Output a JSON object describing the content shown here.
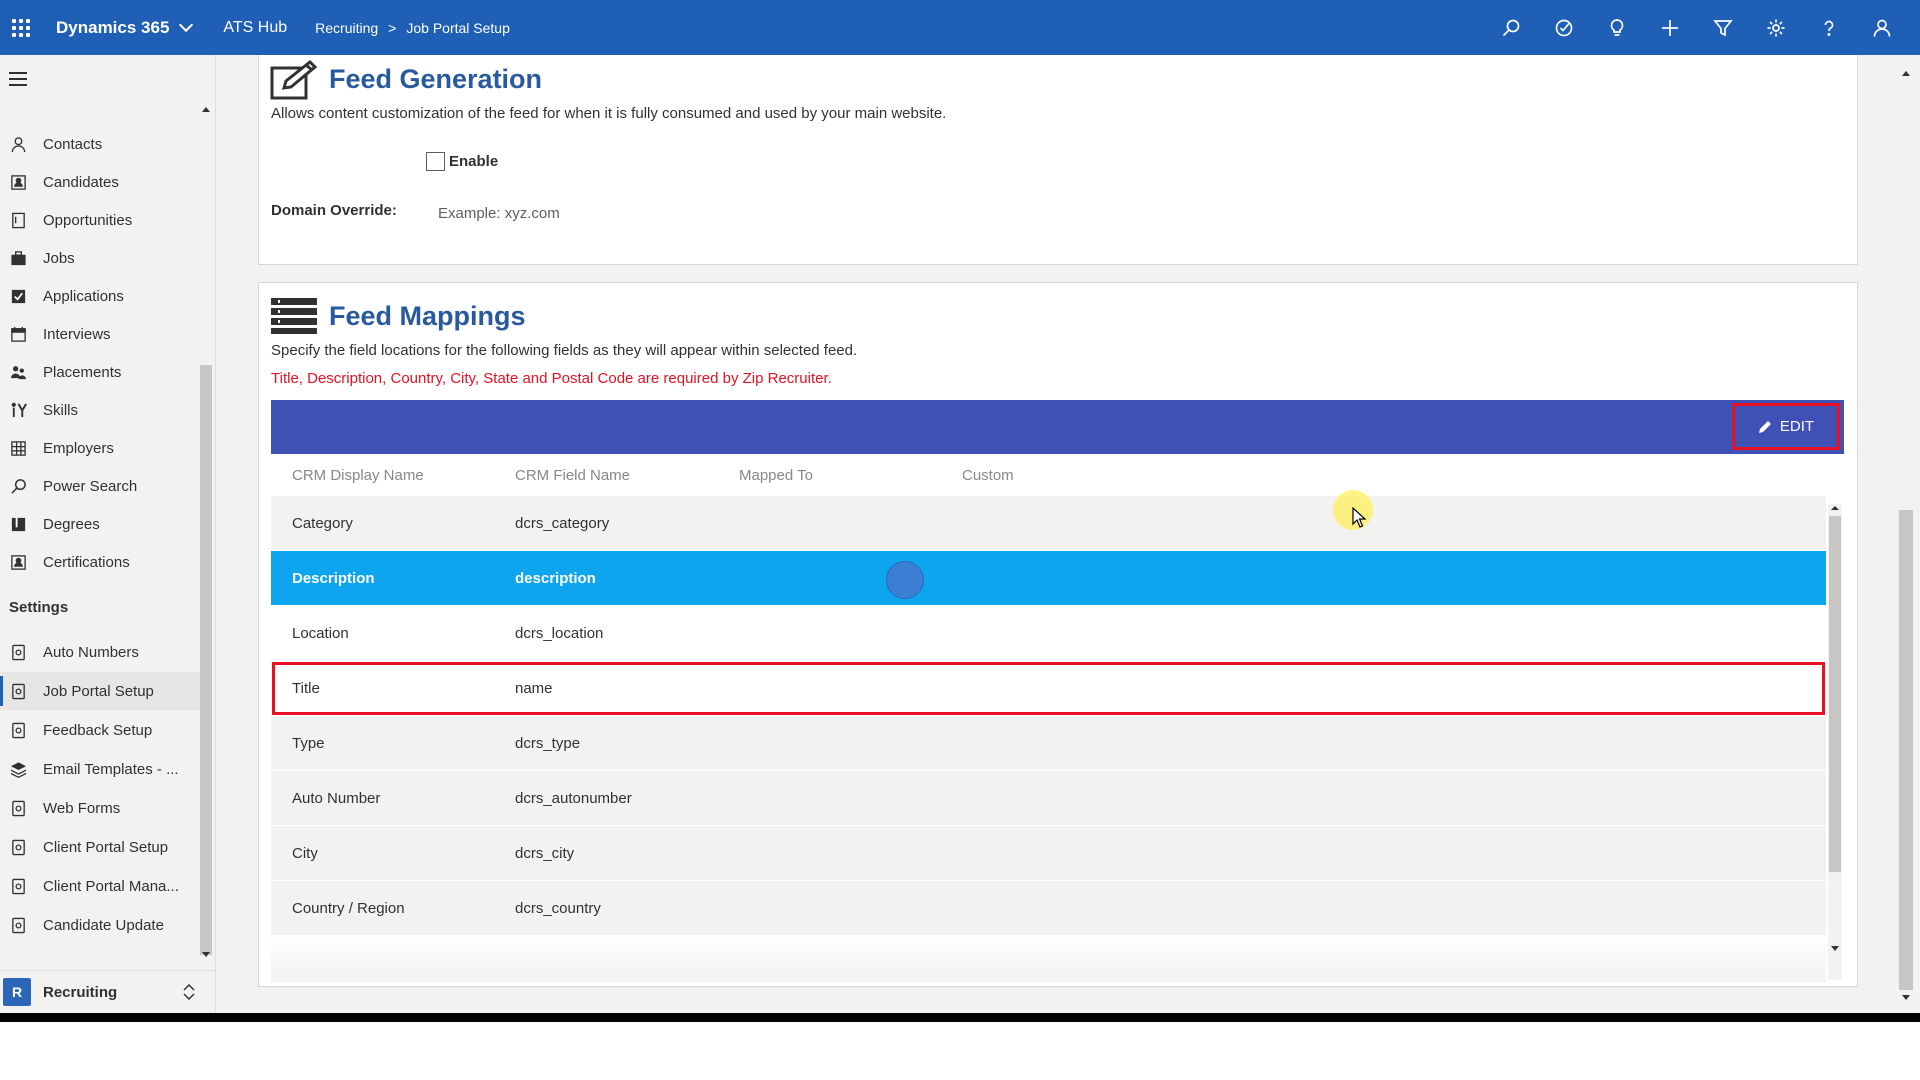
{
  "topbar": {
    "app_title": "Dynamics 365",
    "hub": "ATS Hub",
    "breadcrumb_area": "Recruiting",
    "breadcrumb_sep": ">",
    "breadcrumb_page": "Job Portal Setup",
    "icons": [
      "search-icon",
      "task-icon",
      "lightbulb-icon",
      "plus-icon",
      "filter-icon",
      "settings-icon",
      "help-icon",
      "user-icon"
    ]
  },
  "sidebar": {
    "items": [
      {
        "label": "Contacts",
        "icon": "person-icon"
      },
      {
        "label": "Candidates",
        "icon": "contact-card-icon"
      },
      {
        "label": "Opportunities",
        "icon": "document-icon"
      },
      {
        "label": "Jobs",
        "icon": "briefcase-icon"
      },
      {
        "label": "Applications",
        "icon": "checkbox-icon"
      },
      {
        "label": "Interviews",
        "icon": "calendar-icon"
      },
      {
        "label": "Placements",
        "icon": "people-icon"
      },
      {
        "label": "Skills",
        "icon": "skills-icon"
      },
      {
        "label": "Employers",
        "icon": "building-icon"
      },
      {
        "label": "Power Search",
        "icon": "search-icon"
      },
      {
        "label": "Degrees",
        "icon": "book-icon"
      },
      {
        "label": "Certifications",
        "icon": "certificate-icon"
      }
    ],
    "settings_label": "Settings",
    "settings_items": [
      {
        "label": "Auto Numbers"
      },
      {
        "label": "Job Portal Setup",
        "active": true
      },
      {
        "label": "Feedback Setup"
      },
      {
        "label": "Email Templates - ..."
      },
      {
        "label": "Web Forms"
      },
      {
        "label": "Client Portal Setup"
      },
      {
        "label": "Client Portal Mana..."
      },
      {
        "label": "Candidate Update"
      }
    ],
    "area_badge": "R",
    "area_name": "Recruiting"
  },
  "feed_generation": {
    "title": "Feed Generation",
    "description": "Allows content customization of the feed for when it is fully consumed and used by your main website.",
    "enable_label": "Enable",
    "enable_checked": false,
    "domain_label": "Domain Override:",
    "domain_placeholder": "Example: xyz.com",
    "domain_value": ""
  },
  "feed_mappings": {
    "title": "Feed Mappings",
    "description": "Specify the field locations for the following fields as they will appear within selected feed.",
    "warning": "Title, Description, Country, City, State and Postal Code are required by Zip Recruiter.",
    "edit_label": "EDIT",
    "columns": [
      "CRM Display Name",
      "CRM Field Name",
      "Mapped To",
      "Custom"
    ],
    "rows": [
      {
        "display": "Category",
        "field": "dcrs_category",
        "mapped": "",
        "custom": ""
      },
      {
        "display": "Description",
        "field": "description",
        "mapped": "",
        "custom": "",
        "selected": true
      },
      {
        "display": "Location",
        "field": "dcrs_location",
        "mapped": "",
        "custom": ""
      },
      {
        "display": "Title",
        "field": "name",
        "mapped": "",
        "custom": "",
        "highlighted": true
      },
      {
        "display": "Type",
        "field": "dcrs_type",
        "mapped": "",
        "custom": ""
      },
      {
        "display": "Auto Number",
        "field": "dcrs_autonumber",
        "mapped": "",
        "custom": ""
      },
      {
        "display": "City",
        "field": "dcrs_city",
        "mapped": "",
        "custom": ""
      },
      {
        "display": "Country / Region",
        "field": "dcrs_country",
        "mapped": "",
        "custom": ""
      }
    ]
  },
  "colors": {
    "topbar": "#1f5fb5",
    "section_title": "#2a5a9e",
    "warning": "#e81123",
    "grid_toolbar": "#3f51b5",
    "selected_row": "#0ea5ef"
  }
}
